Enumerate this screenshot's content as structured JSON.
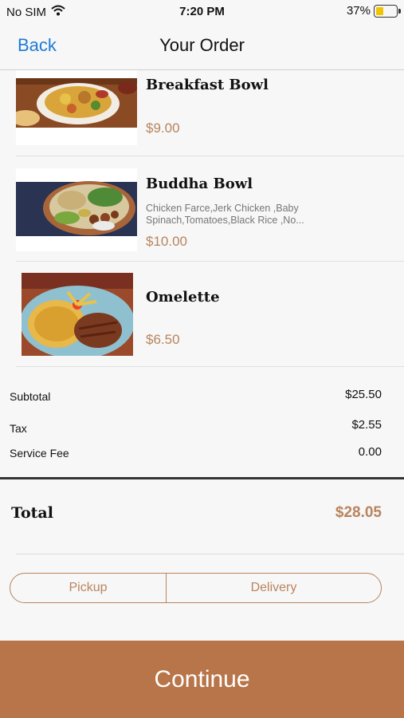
{
  "status_bar": {
    "carrier": "No SIM",
    "time": "7:20 PM",
    "battery": "37%",
    "battery_level": 0.37,
    "icons": [
      "wifi-icon",
      "battery-icon"
    ]
  },
  "nav": {
    "back_label": "Back",
    "title": "Your Order"
  },
  "items": [
    {
      "name": "Breakfast Bowl",
      "description": "",
      "price": "$9.00"
    },
    {
      "name": "Buddha Bowl",
      "description_line1": "Chicken Farce,Jerk Chicken ,Baby",
      "description_line2": "Spinach,Tomatoes,Black Rice ,No...",
      "price": "$10.00"
    },
    {
      "name": "Omelette",
      "description": "",
      "price": "$6.50"
    }
  ],
  "summary": {
    "subtotal_label": "Subtotal",
    "subtotal_value": "$25.50",
    "tax_label": "Tax",
    "tax_value": "$2.55",
    "service_fee_label": "Service Fee",
    "service_fee_value": "0.00",
    "total_label": "Total",
    "total_value": "$28.05"
  },
  "fulfillment": {
    "options": [
      "Pickup",
      "Delivery"
    ]
  },
  "actions": {
    "continue_label": "Continue"
  },
  "colors": {
    "accent": "#b8845e",
    "button": "#b8754a",
    "link": "#1e7bd6",
    "battery": "#f2c400"
  }
}
